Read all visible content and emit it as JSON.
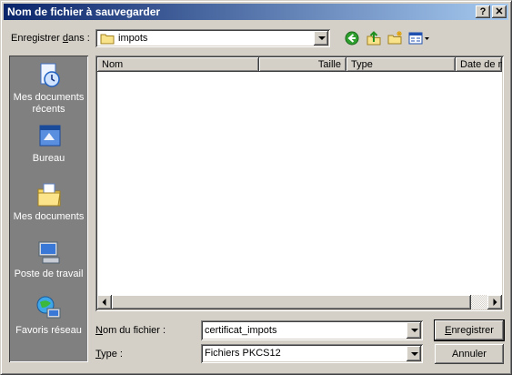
{
  "window": {
    "title": "Nom de fichier à sauvegarder",
    "help_glyph": "?",
    "close_glyph": "✕"
  },
  "save_in": {
    "label_pre": "Enregistrer ",
    "label_accel": "d",
    "label_post": "ans :",
    "value": "impots"
  },
  "toolbar": {
    "icons": [
      "back-icon",
      "up-folder-icon",
      "new-folder-icon",
      "view-menu-icon"
    ]
  },
  "places": [
    {
      "name": "recent",
      "label": "Mes documents récents"
    },
    {
      "name": "desktop",
      "label": "Bureau"
    },
    {
      "name": "documents",
      "label": "Mes documents"
    },
    {
      "name": "computer",
      "label": "Poste de travail"
    },
    {
      "name": "network",
      "label": "Favoris réseau"
    }
  ],
  "file_list": {
    "columns": {
      "name": "Nom",
      "size": "Taille",
      "type": "Type",
      "date": "Date de m"
    }
  },
  "filename": {
    "label_accel": "N",
    "label_rest": "om du fichier :",
    "value": "certificat_impots"
  },
  "filetype": {
    "label_accel": "T",
    "label_rest": "ype :",
    "value": "Fichiers PKCS12"
  },
  "buttons": {
    "save_accel": "E",
    "save_rest": "nregistrer",
    "cancel": "Annuler"
  }
}
